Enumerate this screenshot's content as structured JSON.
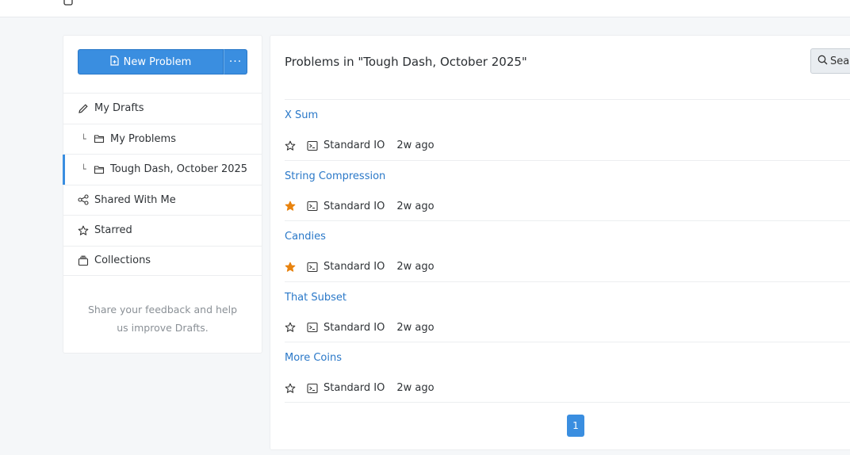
{
  "sidebar": {
    "new_problem_label": "New Problem",
    "more_label": "···",
    "items": [
      {
        "label": "My Drafts",
        "icon": "pencil-icon"
      },
      {
        "label": "My Problems",
        "icon": "folder-icon"
      },
      {
        "label": "Tough Dash, October 2025",
        "icon": "folder-icon",
        "active": true
      },
      {
        "label": "Shared With Me",
        "icon": "share-icon"
      },
      {
        "label": "Starred",
        "icon": "star-icon"
      },
      {
        "label": "Collections",
        "icon": "collections-icon"
      }
    ],
    "feedback": "Share your feedback and help us improve Drafts."
  },
  "main": {
    "title": "Problems in \"Tough Dash, October 2025\"",
    "search_label": "Search",
    "problems": [
      {
        "name": "X Sum",
        "starred": false,
        "io": "Standard IO",
        "time": "2w ago"
      },
      {
        "name": "String Compression",
        "starred": true,
        "io": "Standard IO",
        "time": "2w ago"
      },
      {
        "name": "Candies",
        "starred": true,
        "io": "Standard IO",
        "time": "2w ago"
      },
      {
        "name": "That Subset",
        "starred": false,
        "io": "Standard IO",
        "time": "2w ago"
      },
      {
        "name": "More Coins",
        "starred": false,
        "io": "Standard IO",
        "time": "2w ago"
      }
    ],
    "page": "1"
  },
  "colors": {
    "accent": "#3a8ee0",
    "star_filled": "#e8830f",
    "link": "#2a78c8"
  }
}
